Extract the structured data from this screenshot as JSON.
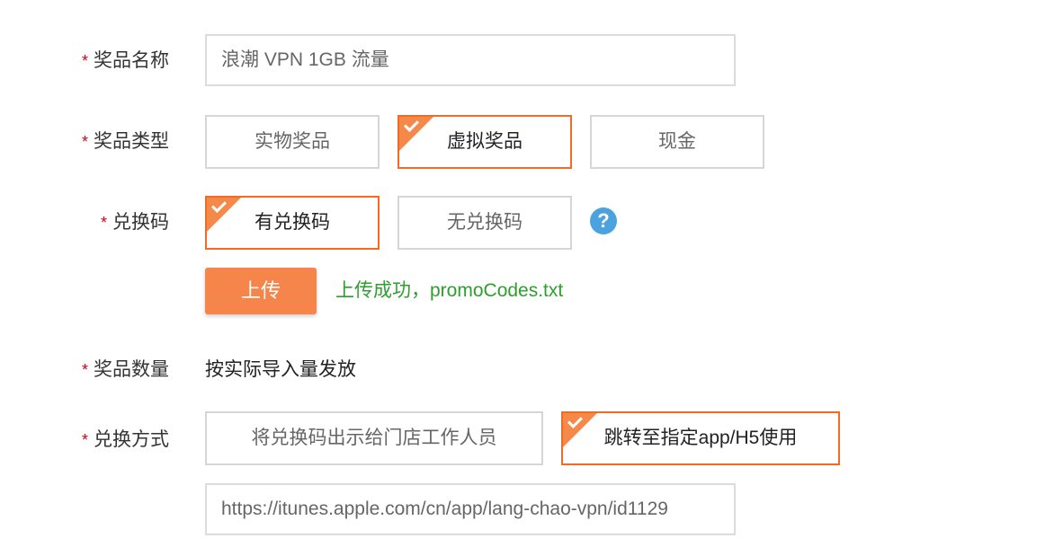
{
  "prize_name": {
    "required_mark": "*",
    "label": "奖品名称",
    "value": "浪潮 VPN 1GB 流量"
  },
  "prize_type": {
    "required_mark": "*",
    "label": "奖品类型",
    "options": [
      "实物奖品",
      "虚拟奖品",
      "现金"
    ],
    "selected": "虚拟奖品"
  },
  "redeem_code": {
    "required_mark": "*",
    "label": "兑换码",
    "options": [
      "有兑换码",
      "无兑换码"
    ],
    "selected": "有兑换码",
    "help_glyph": "?",
    "upload_label": "上传",
    "upload_status": "上传成功，promoCodes.txt"
  },
  "prize_quantity": {
    "required_mark": "*",
    "label": "奖品数量",
    "value": "按实际导入量发放"
  },
  "redeem_method": {
    "required_mark": "*",
    "label": "兑换方式",
    "options": [
      "将兑换码出示给门店工作人员",
      "跳转至指定app/H5使用"
    ],
    "selected": "跳转至指定app/H5使用",
    "url": "https://itunes.apple.com/cn/app/lang-chao-vpn/id1129"
  },
  "colors": {
    "accent": "#f26b25",
    "required": "#d0021b",
    "success": "#2e9e2e",
    "help": "#4aa3df"
  }
}
